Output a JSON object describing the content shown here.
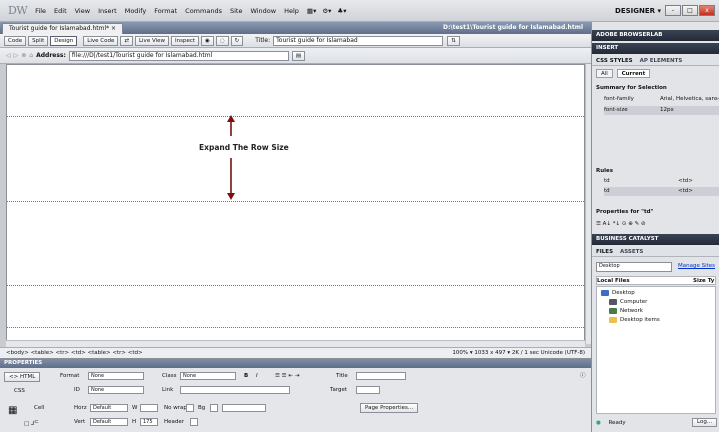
{
  "app": {
    "logo": "DW",
    "menu": [
      "File",
      "Edit",
      "View",
      "Insert",
      "Modify",
      "Format",
      "Commands",
      "Site",
      "Window",
      "Help"
    ],
    "workspace": "DESIGNER ▾",
    "win_buttons": [
      "-",
      "□",
      "x"
    ]
  },
  "document": {
    "tab_label": "Tourist guide for Islamabad.html* ×",
    "path": "D:\\test1\\Tourist guide for Islamabad.html",
    "views": [
      "Code",
      "Split",
      "Design",
      "Live Code",
      "Live View",
      "Inspect"
    ],
    "title_label": "Title:",
    "title_value": "Tourist guide for Islamabad",
    "address_label": "Address:",
    "address_value": "file:///D|/test1/Tourist guide for Islamabad.html",
    "annotation": "Expand The Row Size",
    "status_tags": "<body> <table> <tr> <td> <table> <tr> <td>",
    "status_right": "100% ▾ 1033 x 497 ▾ 2K / 1 sec  Unicode (UTF-8)"
  },
  "properties": {
    "header": "PROPERTIES",
    "html_label": "<> HTML",
    "css_label": "CSS",
    "format_label": "Format",
    "format_value": "None",
    "class_label": "Class",
    "class_value": "None",
    "id_label": "ID",
    "id_value": "None",
    "link_label": "Link",
    "title_label": "Title",
    "target_label": "Target",
    "cell_label": "Cell",
    "horz_label": "Horz",
    "horz_value": "Default",
    "vert_label": "Vert",
    "vert_value": "Default",
    "w_label": "W",
    "h_label": "H",
    "h_value": "175",
    "nowrap_label": "No wrap",
    "bg_label": "Bg",
    "header_label": "Header",
    "page_properties": "Page Properties..."
  },
  "right_panel": {
    "browserlab": "ADOBE BROWSERLAB",
    "insert": "INSERT",
    "css_tab": "CSS STYLES",
    "ap_tab": "AP ELEMENTS",
    "all": "All",
    "current": "Current",
    "summary_title": "Summary for Selection",
    "summary": [
      {
        "prop": "font-family",
        "val": "Arial, Helvetica, sans-se"
      },
      {
        "prop": "font-size",
        "val": "12px"
      }
    ],
    "rules_title": "Rules",
    "rules": [
      {
        "sel": "td",
        "val": "<td>"
      },
      {
        "sel": "td",
        "val": "<td>"
      }
    ],
    "props_for": "Properties for \"td\"",
    "business": "BUSINESS CATALYST",
    "files_tab": "FILES",
    "assets_tab": "ASSETS",
    "location": "Desktop",
    "manage_sites": "Manage Sites",
    "local_files": "Local Files",
    "size_col": "Size Ty",
    "tree": [
      "Desktop",
      "Computer",
      "Network",
      "Desktop items"
    ],
    "ready": "Ready",
    "log": "Log..."
  }
}
